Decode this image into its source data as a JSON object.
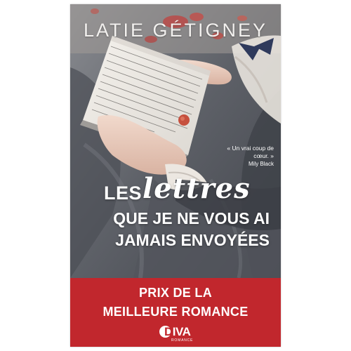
{
  "book": {
    "author": "LATIE GÉTIGNEY",
    "quote_text": "« Un vrai coup de cœur. »",
    "quote_author": "Mily Black",
    "title": {
      "line1_word1": "LES",
      "line1_script": "lettres",
      "line2": "QUE JE NE VOUS AI",
      "line3": "JAMAIS ENVOYÉES"
    },
    "award_line1": "PRIX DE LA",
    "award_line2": "MEILLEURE ROMANCE",
    "publisher": {
      "logo_letter": "D",
      "logo_rest": "IVA",
      "logo_sub": "ROMANCE"
    }
  },
  "colors": {
    "band": "#c1272d",
    "background": "#5e6168",
    "text": "#ffffff"
  },
  "icons": [
    "letter-paper-illustration",
    "rose-petals-illustration",
    "wax-seal-icon",
    "publisher-logo-icon"
  ]
}
